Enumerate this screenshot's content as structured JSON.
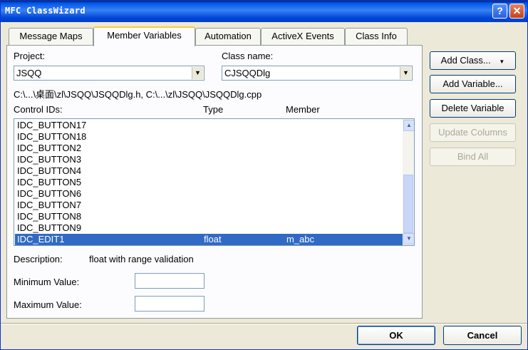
{
  "window": {
    "title": "MFC ClassWizard",
    "help_label": "?",
    "close_label": "✕"
  },
  "tabs": [
    {
      "label": "Message Maps"
    },
    {
      "label": "Member Variables"
    },
    {
      "label": "Automation"
    },
    {
      "label": "ActiveX Events"
    },
    {
      "label": "Class Info"
    }
  ],
  "project": {
    "label": "Project:",
    "value": "JSQQ"
  },
  "class_name": {
    "label": "Class name:",
    "value": "CJSQQDlg"
  },
  "path_text": "C:\\...\\桌面\\zl\\JSQQ\\JSQQDlg.h, C:\\...\\zl\\JSQQ\\JSQQDlg.cpp",
  "columns": {
    "control_ids": "Control IDs:",
    "type": "Type",
    "member": "Member"
  },
  "controls": [
    {
      "id": "IDC_BUTTON17",
      "type": "",
      "member": ""
    },
    {
      "id": "IDC_BUTTON18",
      "type": "",
      "member": ""
    },
    {
      "id": "IDC_BUTTON2",
      "type": "",
      "member": ""
    },
    {
      "id": "IDC_BUTTON3",
      "type": "",
      "member": ""
    },
    {
      "id": "IDC_BUTTON4",
      "type": "",
      "member": ""
    },
    {
      "id": "IDC_BUTTON5",
      "type": "",
      "member": ""
    },
    {
      "id": "IDC_BUTTON6",
      "type": "",
      "member": ""
    },
    {
      "id": "IDC_BUTTON7",
      "type": "",
      "member": ""
    },
    {
      "id": "IDC_BUTTON8",
      "type": "",
      "member": ""
    },
    {
      "id": "IDC_BUTTON9",
      "type": "",
      "member": ""
    },
    {
      "id": "IDC_EDIT1",
      "type": "float",
      "member": "m_abc"
    }
  ],
  "description": {
    "label": "Description:",
    "value": "float with range validation"
  },
  "min_value": {
    "label": "Minimum Value:",
    "value": ""
  },
  "max_value": {
    "label": "Maximum Value:",
    "value": ""
  },
  "buttons": {
    "add_class": "Add Class...",
    "add_class_arrow": "▼",
    "add_variable": "Add Variable...",
    "delete_variable": "Delete Variable",
    "update_columns": "Update Columns",
    "bind_all": "Bind All",
    "ok": "OK",
    "cancel": "Cancel"
  },
  "colors": {
    "selection": "#316ac5",
    "title_bar": "#0058ee",
    "dialog_bg": "#ece9d8"
  }
}
